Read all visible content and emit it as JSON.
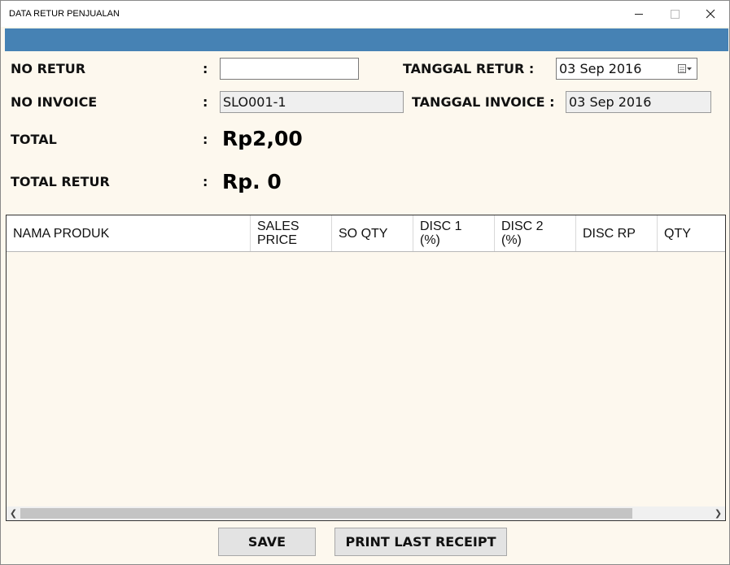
{
  "window": {
    "title": "DATA RETUR PENJUALAN"
  },
  "form": {
    "no_retur_label": "NO RETUR",
    "colon": ":",
    "no_retur_value": "",
    "tanggal_retur_label": "TANGGAL RETUR :",
    "tanggal_retur_value": "03 Sep 2016",
    "no_invoice_label": "NO INVOICE",
    "no_invoice_value": "SLO001-1",
    "tanggal_invoice_label": "TANGGAL INVOICE :",
    "tanggal_invoice_value": "03 Sep 2016",
    "total_label": "TOTAL",
    "total_value": "Rp2,00",
    "total_retur_label": "TOTAL RETUR",
    "total_retur_value": "Rp. 0"
  },
  "grid": {
    "columns": [
      {
        "line1": "NAMA PRODUK",
        "line2": ""
      },
      {
        "line1": "SALES",
        "line2": "PRICE"
      },
      {
        "line1": "SO QTY",
        "line2": ""
      },
      {
        "line1": "DISC 1",
        "line2": "(%)"
      },
      {
        "line1": "DISC 2",
        "line2": "(%)"
      },
      {
        "line1": "DISC RP",
        "line2": ""
      },
      {
        "line1": "QTY",
        "line2": ""
      }
    ],
    "scroll_left_icon": "chevron-left-icon",
    "scroll_right_icon": "chevron-right-icon"
  },
  "buttons": {
    "save_label": "SAVE",
    "print_label": "PRINT LAST RECEIPT"
  },
  "colors": {
    "header_bar": "#4682b4",
    "window_background": "#fdf8ee"
  }
}
